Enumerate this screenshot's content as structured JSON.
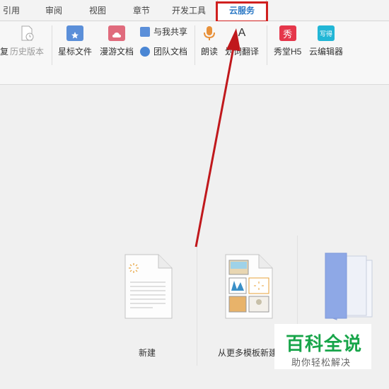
{
  "tabs": [
    {
      "label": "引用",
      "active": false
    },
    {
      "label": "审阅",
      "active": false
    },
    {
      "label": "视图",
      "active": false
    },
    {
      "label": "章节",
      "active": false
    },
    {
      "label": "开发工具",
      "active": false
    },
    {
      "label": "云服务",
      "active": true
    }
  ],
  "ribbon": {
    "cut_label": "复",
    "history_version": "历史版本",
    "star_file": "星标文件",
    "roam_doc": "漫游文档",
    "share_with_me": "与我共享",
    "team_doc": "团队文档",
    "read_aloud": "朗读",
    "translate": "划词翻译",
    "show_h5": "秀堂H5",
    "cloud_editor": "云编辑器",
    "show_icon_text": "秀",
    "editor_icon_text": "写得",
    "translate_icon_text": "A"
  },
  "main": {
    "new_label": "新建",
    "template_label": "从更多模板新建"
  },
  "watermark": {
    "title": "百科全说",
    "subtitle": "助你轻松解决"
  },
  "colors": {
    "active_tab": "#2b78c5",
    "highlight": "#d0201f",
    "arrow": "#c0181c",
    "watermark_green": "#18a54a"
  }
}
